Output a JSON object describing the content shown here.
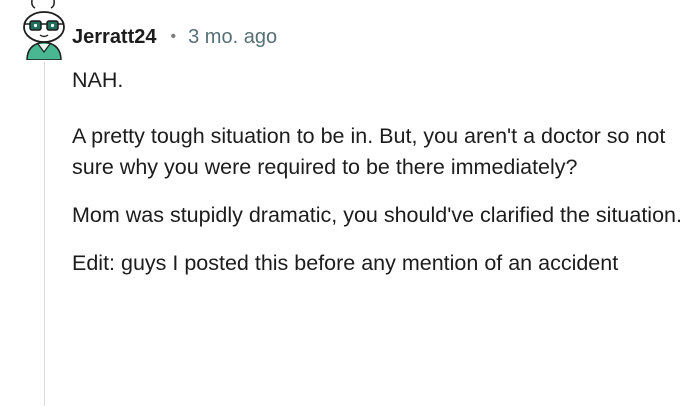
{
  "comment": {
    "username": "Jerratt24",
    "separator": "•",
    "timestamp": "3 mo. ago",
    "paragraphs": [
      "NAH.",
      "A pretty tough situation to be in. But, you aren't a doctor so not sure why you were required to be there immediately?",
      "Mom was stupidly dramatic, you should've clarified the situation.",
      "Edit: guys I posted this before any mention of an accident"
    ]
  },
  "colors": {
    "text": "#1c1c1c",
    "meta": "#576f76",
    "thread_line": "#dadde0",
    "avatar_shirt": "#49b892",
    "avatar_glasses": "#1f6f5c"
  },
  "icons": {
    "avatar": "reddit-snoo-avatar-icon"
  }
}
